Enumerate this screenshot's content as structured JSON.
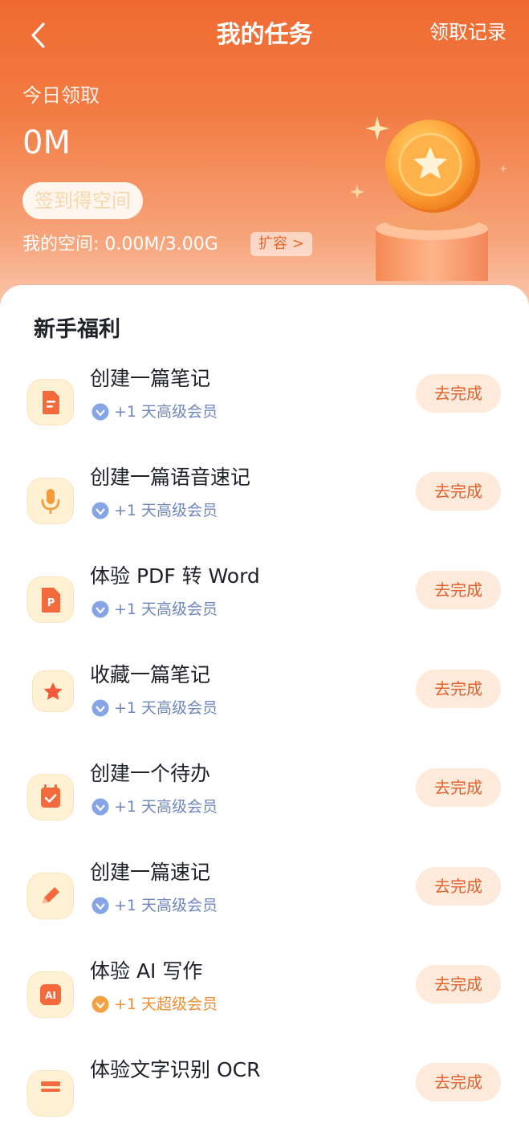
{
  "header": {
    "title": "我的任务",
    "record_label": "领取记录",
    "today_label": "今日领取",
    "today_value": "0M",
    "signin_label": "签到得空间",
    "space_label": "我的空间: 0.00M/3.00G",
    "expand_label": "扩容 >"
  },
  "colors": {
    "brand": "#ef6a32",
    "button_bg": "#fdeadb",
    "button_text": "#e1622e",
    "reward_blue": "#6f86bd",
    "reward_gold": "#ee8e31"
  },
  "section": {
    "title": "新手福利"
  },
  "tasks": [
    {
      "name": "创建一篇笔记",
      "icon": "note-icon",
      "reward": "+1 天高级会员",
      "button": "去完成"
    },
    {
      "name": "创建一篇语音速记",
      "icon": "microphone-icon",
      "reward": "+1 天高级会员",
      "button": "去完成"
    },
    {
      "name": "体验 PDF 转 Word",
      "icon": "pdf-icon",
      "reward": "+1 天高级会员",
      "button": "去完成"
    },
    {
      "name": "收藏一篇笔记",
      "icon": "star-icon",
      "reward": "+1 天高级会员",
      "button": "去完成"
    },
    {
      "name": "创建一个待办",
      "icon": "calendar-check-icon",
      "reward": "+1 天高级会员",
      "button": "去完成"
    },
    {
      "name": "创建一篇速记",
      "icon": "pencil-icon",
      "reward": "+1 天高级会员",
      "button": "去完成"
    },
    {
      "name": "体验 AI 写作",
      "icon": "ai-icon",
      "reward": "+1 天超级会员",
      "button": "去完成"
    },
    {
      "name": "体验文字识别 OCR",
      "icon": "scan-icon",
      "button": "去完成"
    }
  ]
}
